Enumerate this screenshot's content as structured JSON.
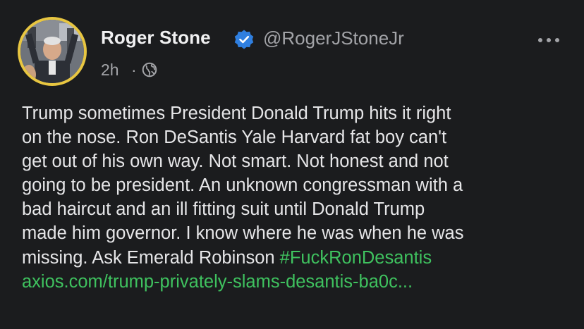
{
  "post": {
    "display_name": "Roger Stone",
    "handle": "@RogerJStoneJr",
    "time": "2h",
    "separator": "·",
    "lines": [
      "Trump sometimes President Donald Trump hits it right",
      "on the nose. Ron DeSantis Yale Harvard fat boy can't",
      "get out of his own way. Not smart. Not honest and not",
      "going to be president. An unknown congressman with a",
      "bad haircut and an ill fitting suit until Donald Trump",
      "made him governor. I know where he was when he was"
    ],
    "last_line_text": "missing. Ask Emerald Robinson ",
    "hashtag": "#FuckRonDesantis",
    "link": "axios.com/trump-privately-slams-desantis-ba0c..."
  },
  "icons": {
    "verified": "verified-badge-icon",
    "more": "more-options-icon",
    "globe": "globe-icon"
  },
  "colors": {
    "background": "#1b1c1e",
    "text": "#e6e6e8",
    "secondary": "#a3a4a8",
    "link_green": "#3fc25f",
    "verified_blue": "#2f7fe0",
    "avatar_ring": "#e8c641"
  }
}
